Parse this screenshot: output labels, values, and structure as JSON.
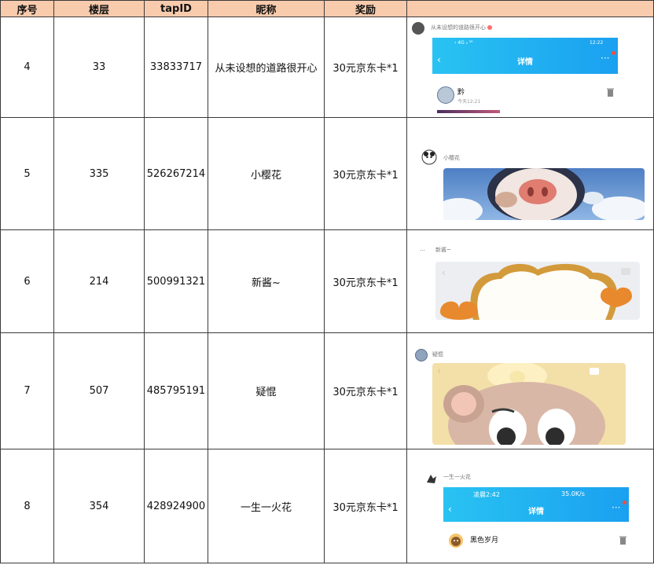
{
  "headers": {
    "no": "序号",
    "floor": "楼层",
    "tapid": "tapID",
    "nickname": "昵称",
    "reward": "奖励",
    "screenshot": ""
  },
  "rows": [
    {
      "no": "4",
      "floor": "33",
      "tapid": "33833717",
      "nickname": "从未设想的道路很开心",
      "reward": "30元京东卡*1",
      "shot": {
        "user": "从未设想的道路很开心",
        "status_left": "‹ 4G ᵢₗ ⁵⁹",
        "status_time": "12:22",
        "title": "详情",
        "card_name": "黔",
        "card_time": "今天12:21"
      }
    },
    {
      "no": "5",
      "floor": "335",
      "tapid": "526267214",
      "nickname": "小樱花",
      "reward": "30元京东卡*1",
      "shot": {
        "user": "小樱花"
      }
    },
    {
      "no": "6",
      "floor": "214",
      "tapid": "500991321",
      "nickname": "新酱~",
      "reward": "30元京东卡*1",
      "shot": {
        "user": "新酱~",
        "avatar_text": "…"
      }
    },
    {
      "no": "7",
      "floor": "507",
      "tapid": "485795191",
      "nickname": "疑惃",
      "reward": "30元京东卡*1",
      "shot": {
        "user": "疑惃"
      }
    },
    {
      "no": "8",
      "floor": "354",
      "tapid": "428924900",
      "nickname": "一生一火花",
      "reward": "30元京东卡*1",
      "shot": {
        "user": "一生一火花",
        "status_left": "凌晨2:42",
        "status_right": "35.0K/s",
        "title": "详情",
        "card_name": "黑色岁月"
      }
    }
  ],
  "colors": {
    "header_bg": "#f8cbad",
    "border": "#3a3a3a",
    "taptap_blue": "#1aa0f0"
  }
}
